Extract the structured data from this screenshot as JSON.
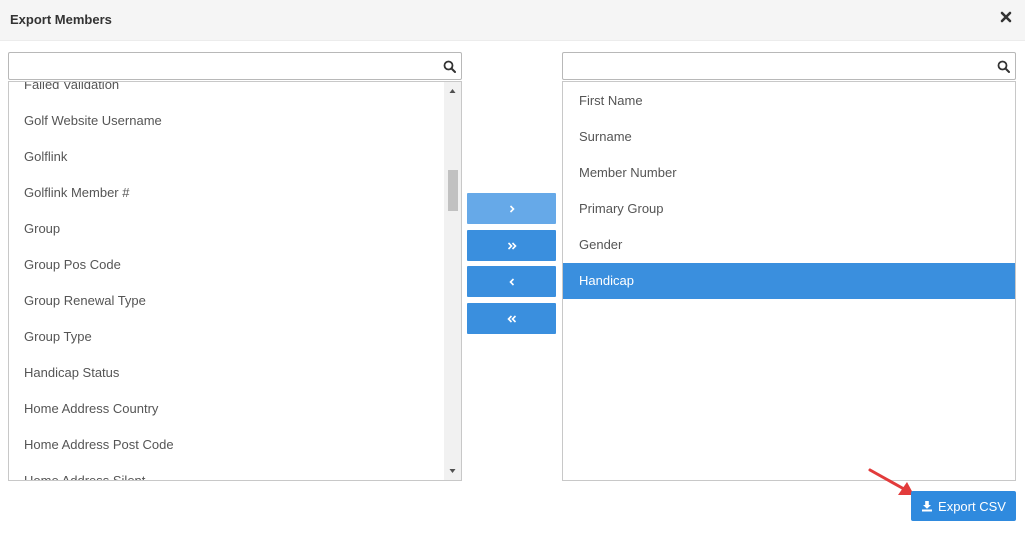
{
  "dialog": {
    "title": "Export Members",
    "close_icon": "close-icon"
  },
  "left_panel": {
    "search": {
      "value": "",
      "placeholder": "",
      "icon": "search-icon"
    },
    "items": [
      "Failed Validation",
      "Golf Website Username",
      "Golflink",
      "Golflink Member #",
      "Group",
      "Group Pos Code",
      "Group Renewal Type",
      "Group Type",
      "Handicap Status",
      "Home Address Country",
      "Home Address Post Code",
      "Home Address Silent"
    ]
  },
  "transfer_buttons": [
    {
      "name": "move-selected-right-button",
      "icon": "chevron-right-icon"
    },
    {
      "name": "move-all-right-button",
      "icon": "double-chevron-right-icon"
    },
    {
      "name": "move-selected-left-button",
      "icon": "chevron-left-icon"
    },
    {
      "name": "move-all-left-button",
      "icon": "double-chevron-left-icon"
    }
  ],
  "right_panel": {
    "search": {
      "value": "",
      "placeholder": "",
      "icon": "search-icon"
    },
    "items": [
      "First Name",
      "Surname",
      "Member Number",
      "Primary Group",
      "Gender",
      "Handicap"
    ],
    "selected": "Handicap"
  },
  "export": {
    "label": "Export CSV",
    "icon": "download-icon"
  },
  "colors": {
    "accent": "#3a8fde",
    "accent_light": "#66a9e8",
    "annotation": "#e23b3b"
  }
}
